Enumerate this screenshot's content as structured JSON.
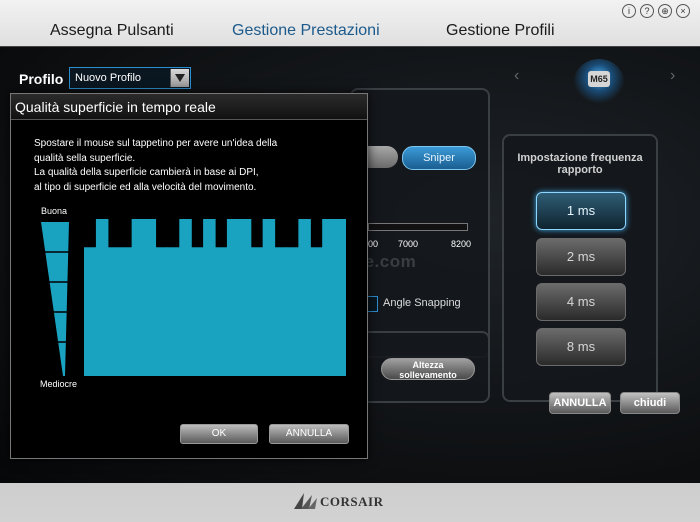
{
  "tabs": [
    {
      "label": "Assegna Pulsanti",
      "active": false
    },
    {
      "label": "Gestione Prestazioni",
      "active": true
    },
    {
      "label": "Gestione Profili",
      "active": false
    }
  ],
  "window_icons": [
    "info-icon",
    "help-icon",
    "globe-icon",
    "close-icon"
  ],
  "profile": {
    "label": "Profilo",
    "selected": "Nuovo Profilo"
  },
  "device_badge": "M65",
  "dpi": {
    "sniper_label": "Sniper",
    "ticks": [
      "00",
      "7000",
      "8200"
    ],
    "angle_snapping_label": "Angle Snapping",
    "lift_height_label_1": "Altezza",
    "lift_height_label_2": "sollevamento"
  },
  "report_rate": {
    "title_1": "Impostazione frequenza",
    "title_2": "rapporto",
    "options": [
      "1 ms",
      "2 ms",
      "4 ms",
      "8 ms"
    ],
    "selected": "1 ms"
  },
  "main_buttons": {
    "cancel": "ANNULLA",
    "close": "chiudi"
  },
  "watermark": "nexthardware.com",
  "dialog": {
    "title": "Qualità superficie in tempo reale",
    "text_lines": [
      "Spostare il mouse sul tappetino per avere un'idea della",
      "qualità sella superficie.",
      "La qualità della superficie cambierà in base ai DPI,",
      "al tipo di superficie ed alla velocità del movimento."
    ],
    "scale_top": "Buona",
    "scale_bottom": "Mediocre",
    "quality_levels": [
      0.82,
      1.0,
      0.82,
      0.82,
      1.0,
      1.0,
      0.82,
      0.82,
      1.0,
      0.82,
      1.0,
      0.82,
      1.0,
      1.0,
      0.82,
      1.0,
      0.82,
      0.82,
      1.0,
      0.82,
      1.0,
      1.0
    ],
    "ok_label": "OK",
    "cancel_label": "ANNULLA"
  },
  "brand": "CORSAIR",
  "colors": {
    "accent": "#1aa3c0",
    "active_tab": "#1c5a8c",
    "select_border": "#2a8fd0"
  }
}
